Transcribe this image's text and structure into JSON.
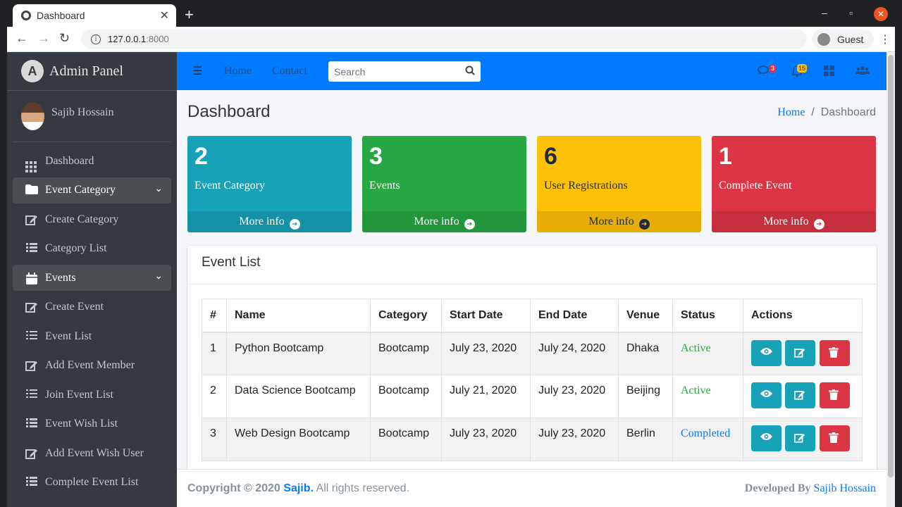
{
  "browser": {
    "tab_title": "Dashboard",
    "url_host": "127.0.0.1",
    "url_port": ":8000",
    "profile": "Guest"
  },
  "sidebar": {
    "brand": "Admin Panel",
    "user_name": "Sajib Hossain",
    "items": [
      {
        "label": "Dashboard",
        "icon": "th-icon"
      },
      {
        "label": "Event Category",
        "icon": "folder-icon"
      },
      {
        "label": "Create Category",
        "icon": "edit-icon"
      },
      {
        "label": "Category List",
        "icon": "list-icon"
      },
      {
        "label": "Events",
        "icon": "calendar-icon"
      },
      {
        "label": "Create Event",
        "icon": "edit-icon"
      },
      {
        "label": "Event List",
        "icon": "list-icon"
      },
      {
        "label": "Add Event Member",
        "icon": "edit-icon"
      },
      {
        "label": "Join Event List",
        "icon": "list-icon"
      },
      {
        "label": "Event Wish List",
        "icon": "list-icon"
      },
      {
        "label": "Add Event Wish User",
        "icon": "edit-icon"
      },
      {
        "label": "Complete Event List",
        "icon": "list-icon"
      }
    ]
  },
  "topnav": {
    "home": "Home",
    "contact": "Contact",
    "search_placeholder": "Search",
    "messages_count": "3",
    "notifications_count": "15"
  },
  "header": {
    "title": "Dashboard",
    "breadcrumb_home": "Home",
    "breadcrumb_sep": "/",
    "breadcrumb_current": "Dashboard"
  },
  "stats": [
    {
      "value": "2",
      "label": "Event Category",
      "more": "More info",
      "color": "#17a2b8"
    },
    {
      "value": "3",
      "label": "Events",
      "more": "More info",
      "color": "#28a745"
    },
    {
      "value": "6",
      "label": "User Registrations",
      "more": "More info",
      "color": "#ffc107"
    },
    {
      "value": "1",
      "label": "Complete Event",
      "more": "More info",
      "color": "#dc3545"
    }
  ],
  "event_list": {
    "title": "Event List",
    "columns": [
      "#",
      "Name",
      "Category",
      "Start Date",
      "End Date",
      "Venue",
      "Status",
      "Actions"
    ],
    "rows": [
      {
        "no": "1",
        "name": "Python Bootcamp",
        "category": "Bootcamp",
        "start": "July 23, 2020",
        "end": "July 24, 2020",
        "venue": "Dhaka",
        "status": "Active"
      },
      {
        "no": "2",
        "name": "Data Science Bootcamp",
        "category": "Bootcamp",
        "start": "July 21, 2020",
        "end": "July 23, 2020",
        "venue": "Beijing",
        "status": "Active"
      },
      {
        "no": "3",
        "name": "Web Design Bootcamp",
        "category": "Bootcamp",
        "start": "July 23, 2020",
        "end": "July 23, 2020",
        "venue": "Berlin",
        "status": "Completed"
      }
    ]
  },
  "footer": {
    "copyright": "Copyright © 2020",
    "author_link": "Sajib.",
    "rights": "All rights reserved.",
    "developed_by": "Developed By",
    "developer": "Sajib Hossain"
  }
}
